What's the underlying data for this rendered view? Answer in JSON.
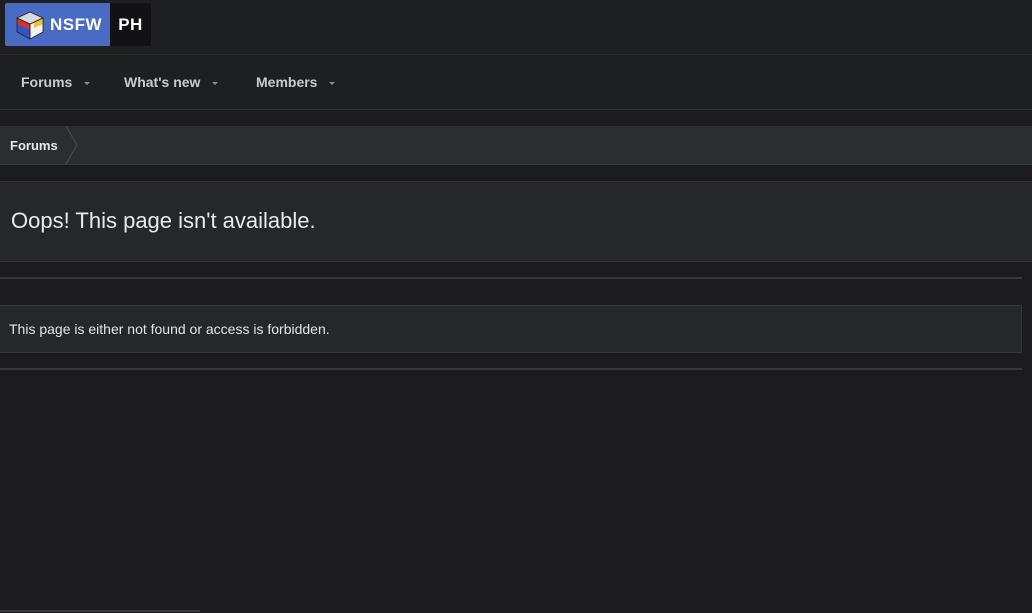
{
  "logo": {
    "left_text": "NSFW",
    "right_text": "PH",
    "icon": "cube-logo-icon",
    "colors": {
      "left_bg": "#4a6bc4",
      "right_bg": "#121214"
    }
  },
  "nav": {
    "items": [
      {
        "label": "Forums",
        "icon": "chevron-down-icon"
      },
      {
        "label": "What's new",
        "icon": "chevron-down-icon"
      },
      {
        "label": "Members",
        "icon": "chevron-down-icon"
      }
    ]
  },
  "breadcrumb": {
    "items": [
      {
        "label": "Forums"
      }
    ]
  },
  "main": {
    "title": "Oops! This page isn't available.",
    "message": "This page is either not found or access is forbidden."
  },
  "theme": {
    "background": "#1c1c1e",
    "panel": "#25272a",
    "breadcrumb_bg": "#2b2e31"
  }
}
